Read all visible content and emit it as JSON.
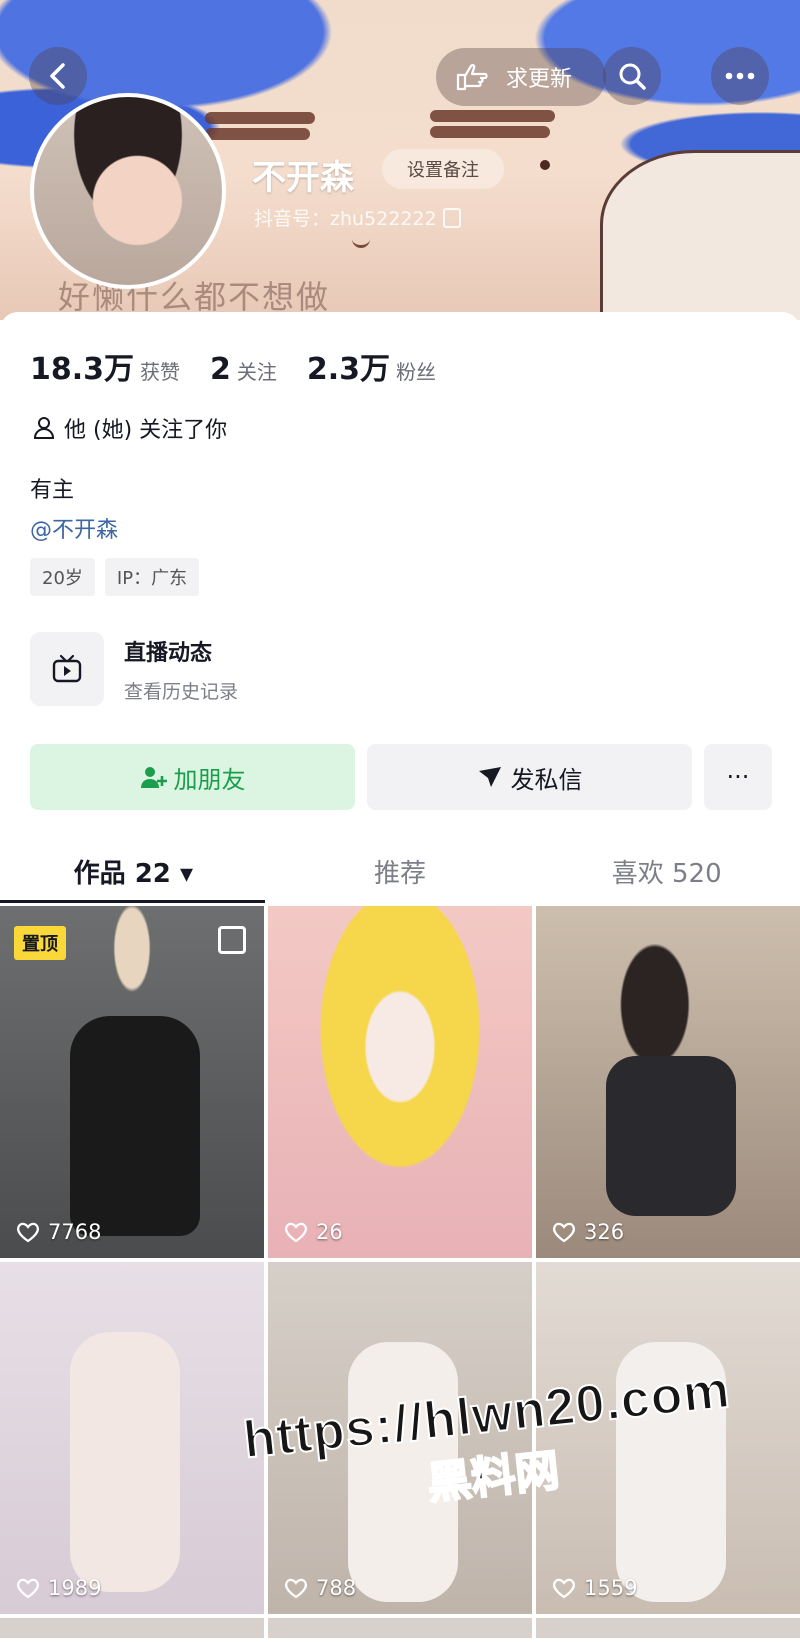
{
  "header": {
    "banner_caption": "好懒什么都不想做",
    "request_update_label": "求更新",
    "back_icon": "chevron-left-icon",
    "search_icon": "search-icon",
    "more_icon": "more-icon"
  },
  "profile": {
    "name": "不开森",
    "set_remark_label": "设置备注",
    "douyin_id": "抖音号：zhu522222"
  },
  "stats": [
    {
      "value": "18.3万",
      "label": "获赞"
    },
    {
      "value": "2",
      "label": "关注"
    },
    {
      "value": "2.3万",
      "label": "粉丝"
    }
  ],
  "follows_you": "他 (她) 关注了你",
  "bio": "有主",
  "mention": "@不开森",
  "tags": [
    "20岁",
    "IP：广东"
  ],
  "live": {
    "title": "直播动态",
    "subtitle": "查看历史记录"
  },
  "actions": {
    "add_friend": "加朋友",
    "message": "发私信",
    "more": "···"
  },
  "tabs": [
    {
      "label": "作品 22 ▾",
      "active": true
    },
    {
      "label": "推荐",
      "active": false
    },
    {
      "label": "喜欢 520",
      "active": false
    }
  ],
  "works": [
    {
      "likes": "7768",
      "pinned_label": "置顶"
    },
    {
      "likes": "26"
    },
    {
      "likes": "326"
    },
    {
      "likes": "1989"
    },
    {
      "likes": "788"
    },
    {
      "likes": "1559"
    }
  ],
  "watermark": {
    "url": "https://hlwn20.com",
    "name": "黑料网"
  },
  "colors": {
    "accent_green": "#1b9e4b",
    "link_blue": "#3d67a3",
    "pin_yellow": "#fbd83a"
  }
}
